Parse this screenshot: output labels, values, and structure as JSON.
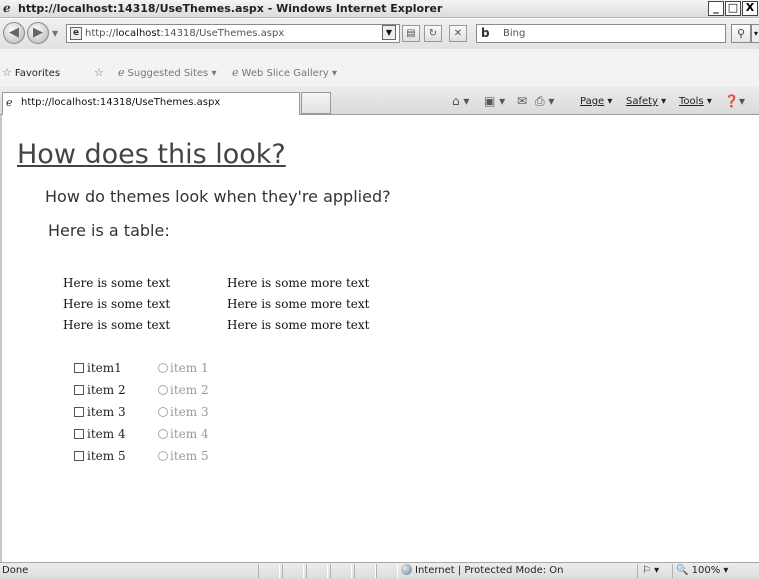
{
  "window": {
    "title": "http://localhost:14318/UseThemes.aspx - Windows Internet Explorer",
    "minimize": "_",
    "maximize": "□",
    "close": "X"
  },
  "address": {
    "url_prefix": "http://",
    "url_host": "localhost",
    "url_rest": ":14318/UseThemes.aspx",
    "search_placeholder": "Bing",
    "search_icon": "magnifier-icon"
  },
  "favorites": {
    "label": "Favorites",
    "items": [
      {
        "label": "Suggested Sites ▾"
      },
      {
        "label": "Web Slice Gallery ▾"
      }
    ]
  },
  "tabs": {
    "active_label": "http://localhost:14318/UseThemes.aspx"
  },
  "commands": {
    "page": "Page",
    "safety": "Safety",
    "tools": "Tools"
  },
  "page": {
    "title": "How does this look?",
    "subtitle": "How do themes look when they're applied?",
    "table_intro": "Here is a table:",
    "table_rows": [
      [
        "Here is some text",
        "Here is some more text"
      ],
      [
        "Here is some text",
        "Here is some more text"
      ],
      [
        "Here is some text",
        "Here is some more text"
      ]
    ],
    "checkboxes": [
      "item1",
      "item 2",
      "item 3",
      "item 4",
      "item 5"
    ],
    "radios": [
      "item 1",
      "item 2",
      "item 3",
      "item 4",
      "item 5"
    ]
  },
  "status": {
    "text": "Done",
    "zone": "Internet | Protected Mode: On",
    "zoom": "100%"
  }
}
